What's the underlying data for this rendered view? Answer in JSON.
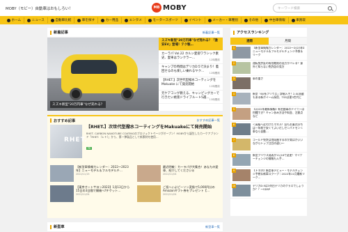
{
  "header": {
    "tagline": "MOBY（モビー）自動車はおもしろい！",
    "logo_badge": "MB",
    "logo_text": "MOBY",
    "search_placeholder": "キーワード検索"
  },
  "nav": [
    {
      "label": "ホーム",
      "icon": "home-icon"
    },
    {
      "label": "ニュース",
      "icon": "news-icon"
    },
    {
      "label": "自動車比較",
      "icon": "compare-icon"
    },
    {
      "label": "車を探す",
      "icon": "car-icon"
    },
    {
      "label": "カー用品",
      "icon": "bag-icon"
    },
    {
      "label": "エンタメ",
      "icon": "star-icon"
    },
    {
      "label": "モータースポーツ",
      "icon": "flag-icon"
    },
    {
      "label": "イベント",
      "icon": "calendar-icon"
    },
    {
      "label": "メーカー・車種別",
      "icon": "list-icon"
    },
    {
      "label": "その他",
      "icon": "dots-icon"
    },
    {
      "label": "中古車情報",
      "icon": "used-car-icon"
    },
    {
      "label": "車買取",
      "icon": "money-icon"
    }
  ],
  "featured": {
    "title": "新着記事",
    "more": "新着記事一覧",
    "hero_caption": "スズキ新型\"20万円車\"なぜ売れる？",
    "items": [
      {
        "text": "スズキ新型\"20万円車\"なぜ売れる？「激安EV」登場！テク製…",
        "meta": "",
        "active": true
      },
      {
        "text": "カーラパ Vol.22 ホルン愛姿ワラシック素史、愛車はランクラー…",
        "meta": "12時間前",
        "active": false
      },
      {
        "text": "キャンプの時間はデリカD:5で決まり！着回せるのも楽しい乗れるヤク…",
        "meta": "12時間前",
        "active": false
      },
      {
        "text": "【RHET.】次世代型撥水コーティングをMakuake にて発売開始",
        "meta": "12時間前",
        "active": false
      },
      {
        "text": "元ケアコンが教える、キャンピングカーで行きたい絶景ドライブルート5選…",
        "meta": "13時間前",
        "active": false
      }
    ]
  },
  "recommended": {
    "title": "おすすめ記事",
    "more": "おすすめ記事一覧",
    "main_image_text": "RHET.",
    "main_title": "【RHET.】次世代型撥水コーティングをMakuakeにて発売開始",
    "main_desc": "RHET. CARBON NANOTUBE COATINGのプロジェクトページがオープン！MOBYから誕生したカーケアブランド「RHET.（レト）」から、第一弾製品として新素材を使用…",
    "main_tag": "PR",
    "cards": [
      {
        "text": "【新型車情報カレンダー：2022〜2023年】ニューモデル＆フルモデルチ…",
        "date": "2022/11/15"
      },
      {
        "text": "最近明敏｜カーラパが大集合！あなたの愛車、紹介してください◎",
        "date": "2022/11/04"
      },
      {
        "text": "【東京オートサロン2023】1月13日から15日の3日間で開催へ‼チケット…",
        "date": "2022/11/04"
      },
      {
        "text": "ご担へいよピーソン変換で5,000円分のAmazonギフト券をプレゼント【…",
        "date": "2022/11/04"
      }
    ]
  },
  "new_cars": {
    "title": "新型車",
    "more": "新型車一覧"
  },
  "ranking": {
    "title": "アクセスランキング",
    "tabs": [
      "週間",
      "月間"
    ],
    "items": [
      {
        "rank": "1",
        "text": "【新型車情報カレンダー：2022〜2023年】ニューモデル＆フルモデルチェンジ予想＆リーク"
      },
      {
        "rank": "2",
        "text": "運転免許証の有効期限の見方がバレる？意外と知らない免許証の見方"
      },
      {
        "rank": "3",
        "text": "車の重さ"
      },
      {
        "rank": "4",
        "text": "新型「60系プリウス」詳細入手！2.0L搭載もある新ボイーム採用、TSSは更3世代に"
      },
      {
        "rank": "5",
        "text": "【2022年最新情報】有名動車のドイツーは何種でき？キャンあみ方法や料金、注意点など"
      },
      {
        "rank": "6",
        "text": "＜高級へ近付けたマネル！旧もお乗式分ちは一年前で安くてよいだしセンパトモン＜車なら自動…"
      },
      {
        "rank": "7",
        "text": "ゴールド免許は何段階するのか実はがいいながらトップ注目の違い〜"
      },
      {
        "rank": "8",
        "text": "新型プリウス発表が11/16で変更！マイナーチェンジの情報も入手…"
      },
      {
        "rank": "9",
        "text": "【トヨタ】新型車デビュー・モデルチェンジ予想＆新車スクープ｜2022年11月最新リーク…"
      },
      {
        "rank": "10",
        "text": "デリカD:5は3列目デリカのクラスでしょうか？？ーSDSP"
      }
    ]
  }
}
